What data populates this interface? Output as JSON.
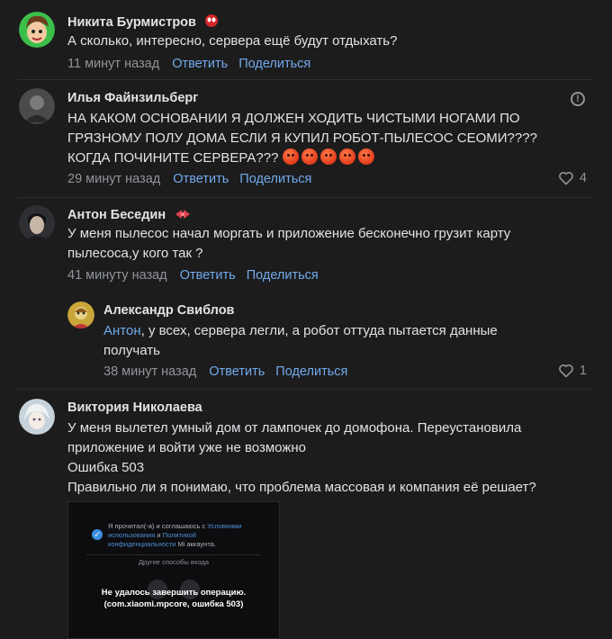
{
  "comments": [
    {
      "author": "Никита Бурмистров",
      "text": "А сколько, интересно, сервера ещё будут отдыхать?",
      "time": "11 минут назад",
      "reply": "Ответить",
      "share": "Поделиться"
    },
    {
      "author": "Илья Файнзильберг",
      "text_line1": "НА КАКОМ ОСНОВАНИИ Я ДОЛЖЕН ХОДИТЬ ЧИСТЫМИ НОГАМИ ПО",
      "text_line2": "ГРЯЗНОМУ ПОЛУ ДОМА ЕСЛИ Я КУПИЛ РОБОТ-ПЫЛЕСОС СЕОМИ????",
      "text_line3": "КОГДА ПОЧИНИТЕ СЕРВЕРА???",
      "time": "29 минут назад",
      "reply": "Ответить",
      "share": "Поделиться",
      "likes": "4"
    },
    {
      "author": "Антон Беседин",
      "text_line1": "У меня пылесос начал моргать и приложение бесконечно грузит карту",
      "text_line2": "пылесоса,у кого так ?",
      "time": "41 минуту назад",
      "reply": "Ответить",
      "share": "Поделиться"
    },
    {
      "author": "Александр Свиблов",
      "mention": "Антон",
      "text_line1": ", у всех, сервера легли, а робот оттуда пытается данные",
      "text_line2": "получать",
      "time": "38 минут назад",
      "reply": "Ответить",
      "share": "Поделиться",
      "likes": "1"
    },
    {
      "author": "Виктория Николаева",
      "text_line1": "У меня вылетел умный дом от лампочек до домофона. Переустановила",
      "text_line2": "приложение и войти уже не возможно",
      "text_line3": "Ошибка 503",
      "text_line4": "Правильно ли я понимаю, что проблема массовая и компания её решает?",
      "attachment": {
        "consent_prefix": "Я прочитал(-а) и соглашаюсь с ",
        "consent_link1": "Условиями использования",
        "consent_mid": " и ",
        "consent_link2": "Политикой конфиденциальности",
        "consent_suffix": " Mi аккаунта.",
        "other_methods": "Другие способы входа",
        "error_line1": "Не удалось завершить операцию.",
        "error_line2": "(com.xiaomi.mpcore, ошибка 503)"
      }
    }
  ],
  "icons": {
    "report": "exclamation-circle-icon",
    "like": "heart-icon"
  },
  "colors": {
    "background": "#1c1c1d",
    "link": "#71aaeb",
    "secondary": "#909499"
  }
}
